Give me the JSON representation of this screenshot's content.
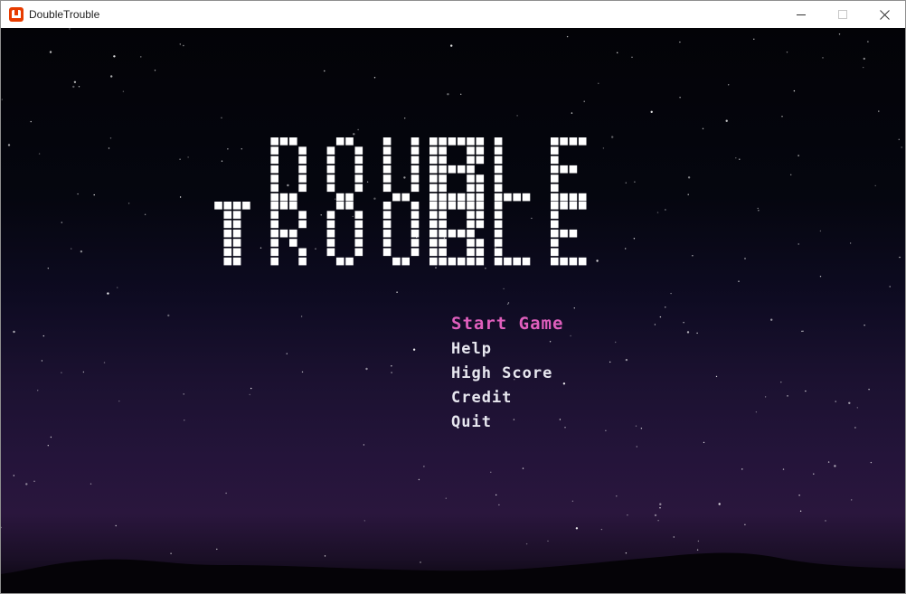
{
  "window": {
    "title": "DoubleTrouble",
    "icon": "monogame-icon",
    "controls": [
      "minimize-icon",
      "maximize-icon",
      "close-icon"
    ]
  },
  "logo": {
    "line1": "DOUBLE",
    "line2": "TROUBLE",
    "shared_letter": "B"
  },
  "menu": {
    "items": [
      {
        "label": "Start Game",
        "selected": true
      },
      {
        "label": "Help",
        "selected": false
      },
      {
        "label": "High Score",
        "selected": false
      },
      {
        "label": "Credit",
        "selected": false
      },
      {
        "label": "Quit",
        "selected": false
      }
    ]
  },
  "colors": {
    "selected_item": "#e05fbd",
    "menu_item": "#e7e7ef",
    "logo_blocks": "#ffffff",
    "sky_top": "#030307",
    "sky_bottom": "#2a163d"
  }
}
